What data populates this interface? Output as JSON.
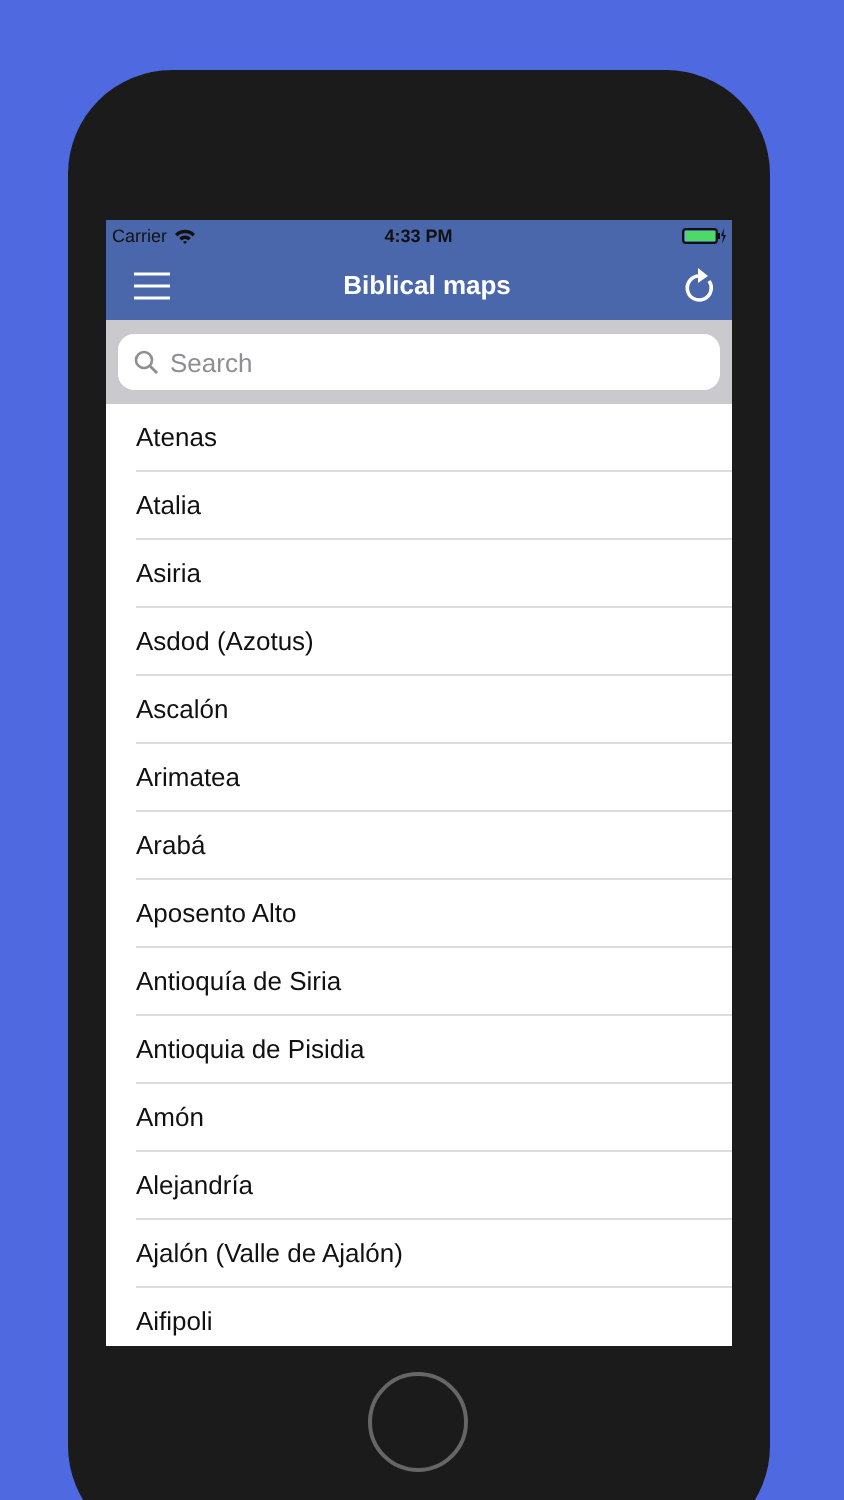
{
  "status_bar": {
    "carrier": "Carrier",
    "time": "4:33 PM"
  },
  "nav_bar": {
    "title": "Biblical maps"
  },
  "search": {
    "placeholder": "Search"
  },
  "places": [
    "Atenas",
    "Atalia",
    "Asiria",
    "Asdod (Azotus)",
    "Ascalón",
    "Arimatea",
    "Arabá",
    "Aposento Alto",
    "Antioquía de Siria",
    "Antioquia de Pisidia",
    "Amón",
    "Alejandría",
    "Ajalón (Valle de Ajalón)",
    "Aifipoli"
  ]
}
